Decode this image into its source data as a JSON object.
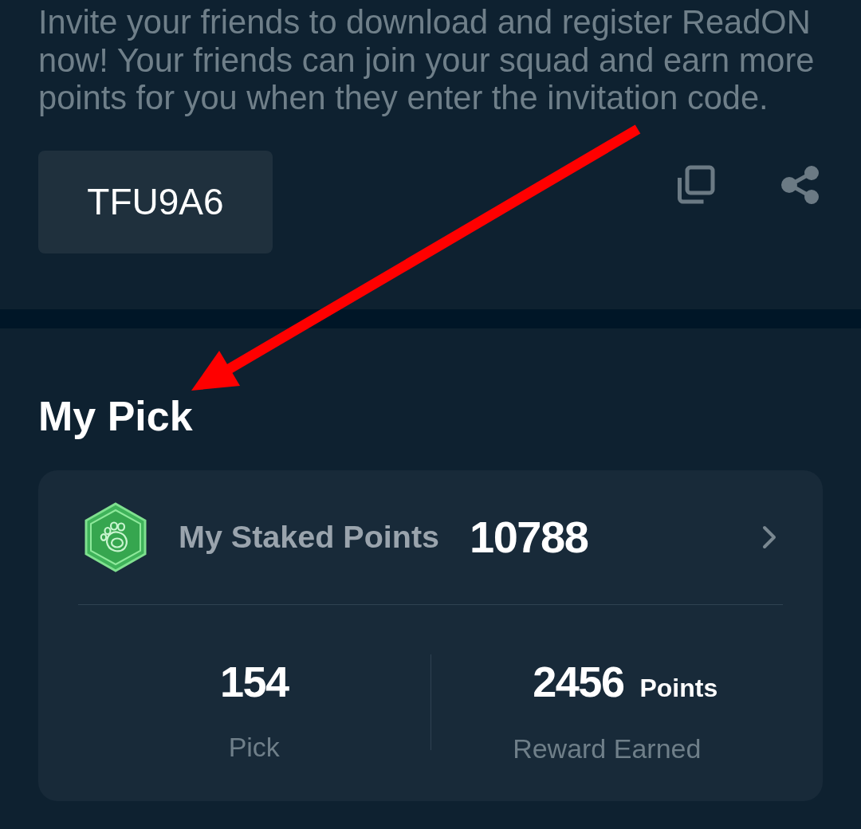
{
  "invite": {
    "message": "Invite your friends to download and register ReadON now! Your friends can join your squad and earn more points for you when they enter the invitation code.",
    "code": "TFU9A6"
  },
  "my_pick": {
    "title": "My Pick",
    "staked": {
      "label": "My Staked Points",
      "value": "10788"
    },
    "stats": [
      {
        "value": "154",
        "label": "Pick"
      },
      {
        "value": "2456",
        "unit": "Points",
        "label": "Reward Earned"
      }
    ]
  }
}
